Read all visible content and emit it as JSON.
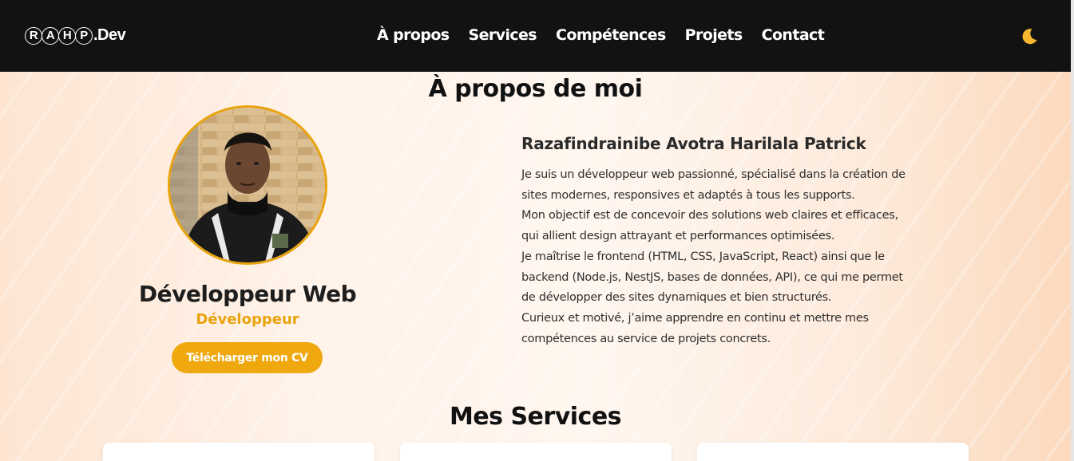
{
  "navbar": {
    "logo_letters": [
      "R",
      "A",
      "H",
      "P"
    ],
    "logo_suffix": ".Dev",
    "links": [
      "À propos",
      "Services",
      "Compétences",
      "Projets",
      "Contact"
    ],
    "theme_icon": "moon-icon"
  },
  "about": {
    "title": "À propos de moi",
    "role": "Développeur Web",
    "subrole": "Développeur",
    "cv_button": "Télécharger mon CV",
    "name": "Razafindrainibe Avotra Harilala Patrick",
    "bio_lines": [
      "Je suis un développeur web passionné, spécialisé dans la création de",
      "sites modernes, responsives et adaptés à tous les supports.",
      "Mon objectif est de concevoir des solutions web claires et efficaces,",
      "qui allient design attrayant et performances optimisées.",
      "Je maîtrise le frontend (HTML, CSS, JavaScript, React) ainsi que le",
      "backend (Node.js, NestJS, bases de données, API), ce qui me permet",
      "de développer des sites dynamiques et bien structurés.",
      "Curieux et motivé, j’aime apprendre en continu et mettre mes",
      "compétences au service de projets concrets."
    ]
  },
  "services": {
    "title": "Mes Services"
  },
  "colors": {
    "accent": "#efa80e",
    "navbar_bg": "#121212"
  }
}
